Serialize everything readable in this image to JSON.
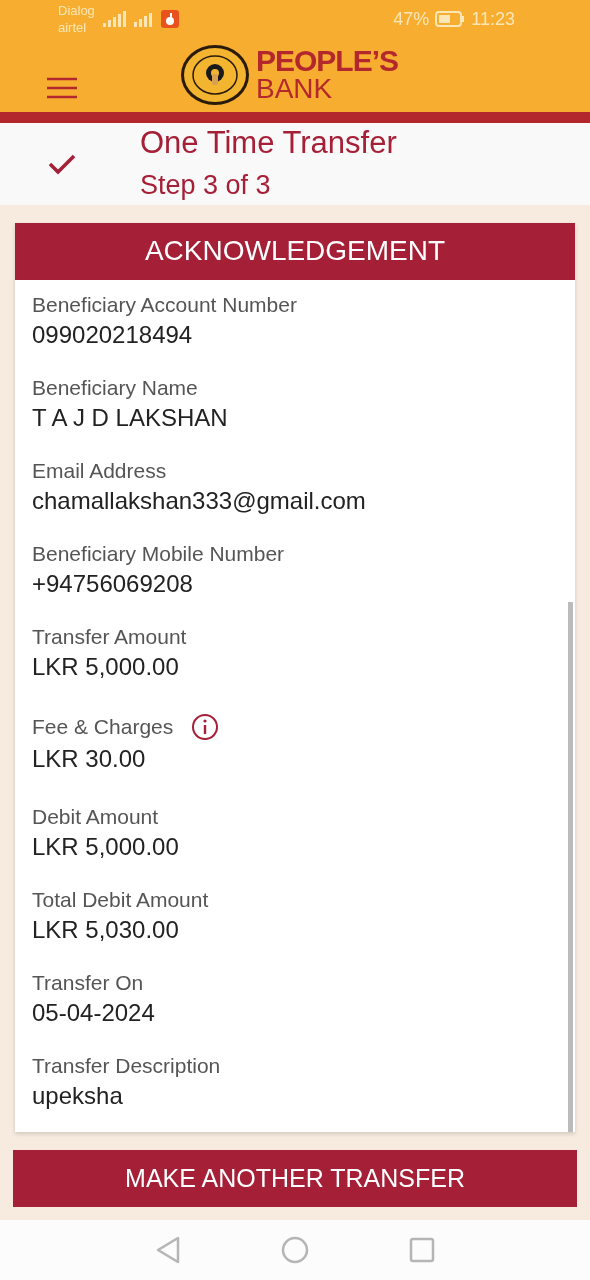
{
  "status_bar": {
    "carrier_1": "Dialog",
    "carrier_2": "airtel",
    "battery": "47%",
    "time": "11:23"
  },
  "header": {
    "logo_line_1": "PEOPLE’S",
    "logo_line_2": "BANK"
  },
  "step": {
    "title": "One Time Transfer",
    "subtitle": "Step 3 of 3"
  },
  "card": {
    "title": "ACKNOWLEDGEMENT",
    "fields": [
      {
        "kind": "plain",
        "label": "Beneficiary Account Number",
        "value": "099020218494"
      },
      {
        "kind": "plain",
        "label": "Beneficiary Name",
        "value": "T A J D LAKSHAN"
      },
      {
        "kind": "plain",
        "label": "Email Address",
        "value": "chamallakshan333@gmail.com"
      },
      {
        "kind": "plain",
        "label": "Beneficiary Mobile Number",
        "value": "+94756069208"
      },
      {
        "kind": "plain",
        "label": "Transfer Amount",
        "value": "LKR 5,000.00"
      },
      {
        "kind": "info",
        "label": "Fee & Charges",
        "value": "LKR 30.00"
      },
      {
        "kind": "plain",
        "label": "Debit Amount",
        "value": "LKR 5,000.00"
      },
      {
        "kind": "plain",
        "label": "Total Debit Amount",
        "value": "LKR 5,030.00"
      },
      {
        "kind": "plain",
        "label": "Transfer On",
        "value": "05-04-2024"
      },
      {
        "kind": "plain",
        "label": "Transfer Description",
        "value": "upeksha"
      }
    ]
  },
  "button": "MAKE ANOTHER TRANSFER"
}
